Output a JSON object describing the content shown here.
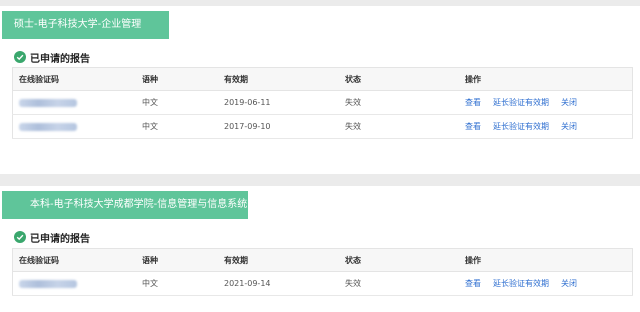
{
  "table_headers": {
    "code": "在线验证码",
    "language": "语种",
    "validity": "有效期",
    "status": "状态",
    "actions": "操作"
  },
  "section_title": "已申请的报告",
  "action_labels": {
    "view": "查看",
    "extend": "延长验证有效期",
    "close": "关闭"
  },
  "colors": {
    "banner": "#5fc59a",
    "check": "#3aa76d",
    "link": "#2f6fd0"
  },
  "degrees": [
    {
      "title": "硕士-电子科技大学-企业管理",
      "rows": [
        {
          "code": "",
          "language": "中文",
          "validity": "2019-06-11",
          "status": "失效"
        },
        {
          "code": "",
          "language": "中文",
          "validity": "2017-09-10",
          "status": "失效"
        }
      ]
    },
    {
      "title": "本科-电子科技大学成都学院-信息管理与信息系统",
      "rows": [
        {
          "code": "",
          "language": "中文",
          "validity": "2021-09-14",
          "status": "失效"
        }
      ]
    }
  ]
}
